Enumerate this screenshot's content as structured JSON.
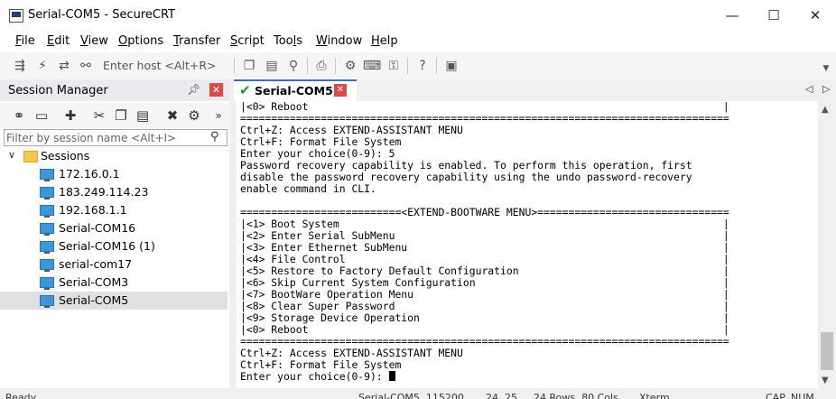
{
  "window": {
    "title": "Serial-COM5 - SecureCRT",
    "minimize": "—",
    "maximize": "☐",
    "close": "✕"
  },
  "menu": [
    "File",
    "Edit",
    "View",
    "Options",
    "Transfer",
    "Script",
    "Tools",
    "Window",
    "Help"
  ],
  "menu_mnemonics": [
    "F",
    "E",
    "V",
    "O",
    "T",
    "S",
    "l",
    "W",
    "H"
  ],
  "toolbar": {
    "host_placeholder": "Enter host <Alt+R>"
  },
  "session_manager": {
    "title": "Session Manager",
    "filter_placeholder": "Filter by session name <Alt+I>",
    "root_folder": "Sessions",
    "sessions": [
      "172.16.0.1",
      "183.249.114.23",
      "192.168.1.1",
      "Serial-COM16",
      "Serial-COM16 (1)",
      "serial-com17",
      "Serial-COM3",
      "Serial-COM5"
    ],
    "selected": "Serial-COM5"
  },
  "tab": {
    "label": "Serial-COM5"
  },
  "terminal": {
    "lines_top": [
      "|<0> Reboot                                                                   |",
      "===============================================================================",
      "Ctrl+Z: Access EXTEND-ASSISTANT MENU",
      "Ctrl+F: Format File System",
      "Enter your choice(0-9): 5",
      "Password recovery capability is enabled. To perform this operation, first",
      "disable the password recovery capability using the undo password-recovery",
      "enable command in CLI.",
      "",
      "==========================<EXTEND-BOOTWARE MENU>===============================",
      "|<1> Boot System                                                              |",
      "|<2> Enter Serial SubMenu                                                     |",
      "|<3> Enter Ethernet SubMenu                                                   |",
      "|<4> File Control                                                             |",
      "|<5> Restore to Factory Default Configuration                                 |",
      "|<6> Skip Current System Configuration                                        |",
      "|<7> BootWare Operation Menu                                                  |",
      "|<8> Clear Super Password                                                     |",
      "|<9> Storage Device Operation                                                 |",
      "|<0> Reboot                                                                   |",
      "===============================================================================",
      "Ctrl+Z: Access EXTEND-ASSISTANT MENU",
      "Ctrl+F: Format File System"
    ],
    "prompt": "Enter your choice(0-9): "
  },
  "statusbar": {
    "ready": "Ready",
    "session": "Serial-COM5, 115200",
    "position": "24, 25",
    "size": "24 Rows, 80 Cols",
    "term_type": "Xterm",
    "caps": "CAP",
    "num": "NUM"
  }
}
